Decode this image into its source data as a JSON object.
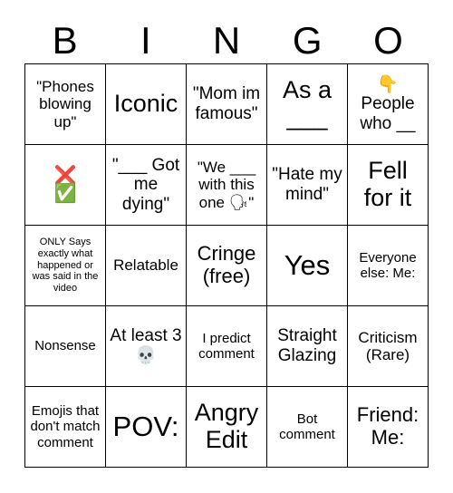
{
  "card": {
    "title": "BINGO",
    "header_letters": [
      "B",
      "I",
      "N",
      "G",
      "O"
    ],
    "background_color": "#ffffff",
    "border_color": "#000000",
    "text_color": "#000000",
    "rows": 5,
    "columns": 5,
    "cells": [
      [
        {
          "text": "\"Phones blowing up\"",
          "size": "s"
        },
        {
          "text": "Iconic",
          "size": "xl"
        },
        {
          "text": "\"Mom im famous\"",
          "size": "m"
        },
        {
          "text": "As a ___",
          "size": "xl"
        },
        {
          "text": "👇\nPeople who __",
          "size": "m",
          "emoji": "pointing-down"
        }
      ],
      [
        {
          "text": "❌\n✅",
          "size": "emoji",
          "emoji": "cross-mark-and-check-mark"
        },
        {
          "text": "\"___ Got me dying\"",
          "size": "m"
        },
        {
          "text": "\"We ___ with this one 🗣\"",
          "size": "s",
          "emoji": "speaking-head"
        },
        {
          "text": "\"Hate my mind\"",
          "size": "m"
        },
        {
          "text": "Fell for it",
          "size": "xl"
        }
      ],
      [
        {
          "text": "ONLY Says exactly what happened or was said in the video",
          "size": "xxs"
        },
        {
          "text": "Relatable",
          "size": "s"
        },
        {
          "text": "Cringe (free)",
          "size": "l"
        },
        {
          "text": "Yes",
          "size": "xxl"
        },
        {
          "text": "Everyone else: Me:",
          "size": "xs"
        }
      ],
      [
        {
          "text": "Nonsense",
          "size": "xs"
        },
        {
          "text": "At least 3 💀",
          "size": "m",
          "emoji": "skull"
        },
        {
          "text": "I predict comment",
          "size": "xs"
        },
        {
          "text": "Straight Glazing",
          "size": "m"
        },
        {
          "text": "Criticism (Rare)",
          "size": "s"
        }
      ],
      [
        {
          "text": "Emojis that don't match comment",
          "size": "xs"
        },
        {
          "text": "POV:",
          "size": "xxl"
        },
        {
          "text": "Angry Edit",
          "size": "xl"
        },
        {
          "text": "Bot comment",
          "size": "xs"
        },
        {
          "text": "Friend: Me:",
          "size": "l"
        }
      ]
    ]
  }
}
